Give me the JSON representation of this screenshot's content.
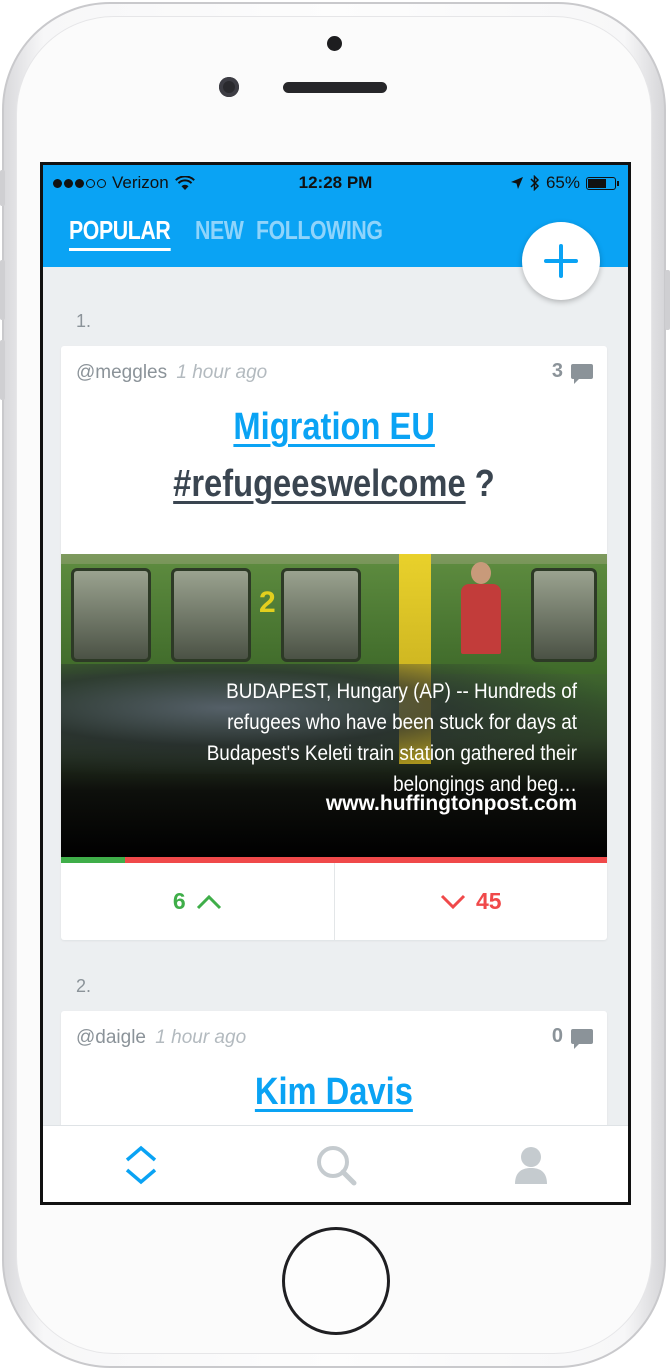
{
  "status_bar": {
    "carrier": "Verizon",
    "time": "12:28 PM",
    "battery": "65%"
  },
  "tabs": [
    {
      "label": "POPULAR",
      "active": true
    },
    {
      "label": "NEW",
      "active": false
    },
    {
      "label": "FOLLOWING",
      "active": false
    }
  ],
  "fab": {
    "icon": "plus-icon"
  },
  "posts": [
    {
      "rank": "1.",
      "author": "@meggles",
      "time_ago": "1 hour ago",
      "comment_count": "3",
      "title_line1": "Migration EU",
      "title_line2": "#refugeeswelcome",
      "title_suffix": "?",
      "media": {
        "description": "BUDAPEST, Hungary (AP) -- Hundreds of refugees who have been stuck for days at Budapest's Keleti train station gathered their belongings and beg…",
        "source": "www.huffingtonpost.com"
      },
      "upvotes": "6",
      "downvotes": "45",
      "upvote_fraction": 0.118
    },
    {
      "rank": "2.",
      "author": "@daigle",
      "time_ago": "1 hour ago",
      "comment_count": "0",
      "title_line1": "Kim Davis"
    }
  ],
  "bottom_nav": [
    {
      "icon": "feed-chevrons-icon",
      "active": true
    },
    {
      "icon": "search-icon",
      "active": false
    },
    {
      "icon": "profile-icon",
      "active": false
    }
  ],
  "colors": {
    "accent": "#0aa3f4",
    "upvote": "#3fae49",
    "downvote": "#f0494a",
    "muted_text": "#8b9399",
    "dark_title": "#3a4550"
  }
}
